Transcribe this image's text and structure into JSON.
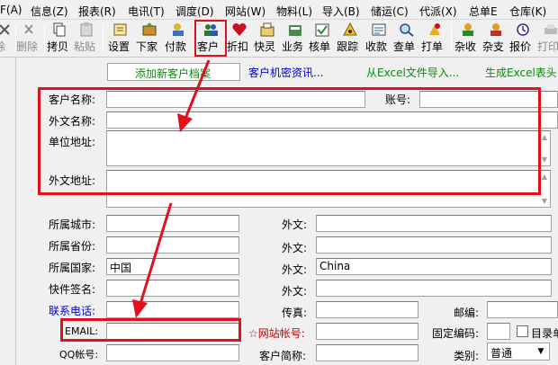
{
  "menu": [
    "F(A)",
    "信息(Z)",
    "报表(R)",
    "电讯(T)",
    "调度(D)",
    "网站(W)",
    "物料(L)",
    "导入(B)",
    "储运(C)",
    "代派(X)",
    "总单E",
    "仓库(K)"
  ],
  "toolbar": [
    {
      "label": "除",
      "icon": "delete-icon"
    },
    {
      "label": "拷贝",
      "icon": "copy-icon"
    },
    {
      "label": "粘贴",
      "icon": "paste-icon"
    },
    {
      "label": "设置",
      "icon": "settings-icon"
    },
    {
      "label": "下家",
      "icon": "downstream-icon"
    },
    {
      "label": "付款",
      "icon": "payment-icon"
    },
    {
      "label": "客户",
      "icon": "customer-icon"
    },
    {
      "label": "折扣",
      "icon": "discount-icon"
    },
    {
      "label": "快灵",
      "icon": "quick-icon"
    },
    {
      "label": "业务",
      "icon": "business-icon"
    },
    {
      "label": "核单",
      "icon": "verify-icon"
    },
    {
      "label": "跟踪",
      "icon": "track-icon"
    },
    {
      "label": "收款",
      "icon": "receipt-icon"
    },
    {
      "label": "查单",
      "icon": "query-icon"
    },
    {
      "label": "打单",
      "icon": "print-order-icon"
    },
    {
      "label": "杂收",
      "icon": "misc-income-icon"
    },
    {
      "label": "杂支",
      "icon": "misc-expense-icon"
    },
    {
      "label": "报价",
      "icon": "quote-icon"
    },
    {
      "label": "打印",
      "icon": "printer-icon"
    }
  ],
  "toolbar_extra": {
    "delete_label": "删除"
  },
  "links": {
    "add_customer": "添加新客户档案",
    "secret": "客户机密资讯...",
    "excel_import": "从Excel文件导入...",
    "excel_header": "生成Excel表头"
  },
  "labels": {
    "name": "客户名称:",
    "account": "账号:",
    "foreign_name": "外文名称:",
    "address": "单位地址:",
    "foreign_address": "外文地址:",
    "city": "所属城市:",
    "province": "所属省份:",
    "country": "所属国家:",
    "courier_sign": "快件签名:",
    "contact_phone": "联系电话:",
    "email": "EMAIL:",
    "qq": "QQ帐号:",
    "foreign": "外文:",
    "fax": "传真:",
    "zip": "邮编:",
    "website_account": "☆网站帐号:",
    "fixed_code": "固定编码:",
    "directory": "目录单",
    "short_name": "客户简称:",
    "category": "类别:"
  },
  "values": {
    "country": "中国",
    "country_foreign": "China",
    "category": "普通"
  },
  "colors": {
    "highlight": "#e0101e",
    "link_green": "#0a8a0a",
    "link_blue": "#0000c8"
  }
}
